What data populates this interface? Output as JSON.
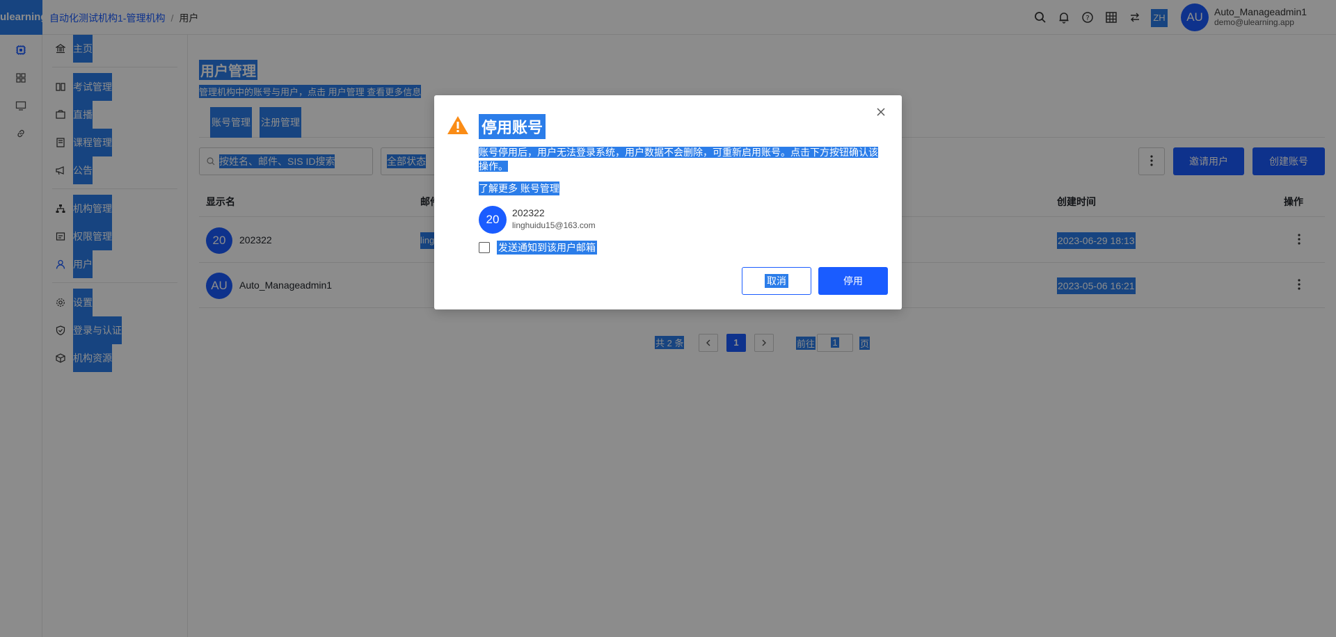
{
  "colors": {
    "accent": "#1a5cff",
    "selection": "#2b7de9",
    "warning": "#fa8c16"
  },
  "app": {
    "logo": "ulearning"
  },
  "breadcrumb": {
    "org": "自动化测试机构1-管理机构",
    "current": "用户"
  },
  "topbar": {
    "icons": [
      "search-icon",
      "bell-icon",
      "help-icon",
      "grid-icon",
      "switch-icon"
    ],
    "lang": "ZH",
    "avatar": "AU",
    "user_name": "Auto_Manageadmin1",
    "user_email": "demo@ulearning.app"
  },
  "rail": {
    "icons": [
      "chip-icon",
      "apps-icon",
      "monitor-icon",
      "link-icon"
    ]
  },
  "menu": {
    "items": [
      {
        "label": "主页",
        "icon": "bank-icon"
      },
      {
        "label": "考试管理",
        "icon": "book-icon"
      },
      {
        "label": "直播",
        "icon": "camera-icon"
      },
      {
        "label": "课程管理",
        "icon": "course-icon"
      },
      {
        "label": "公告",
        "icon": "megaphone-icon"
      },
      {
        "label": "机构管理",
        "icon": "org-icon"
      },
      {
        "label": "权限管理",
        "icon": "permission-icon"
      },
      {
        "label": "用户",
        "icon": "user-icon"
      },
      {
        "label": "设置",
        "icon": "gear-icon"
      },
      {
        "label": "登录与认证",
        "icon": "shield-icon"
      },
      {
        "label": "机构资源",
        "icon": "box-icon"
      }
    ]
  },
  "page": {
    "title": "用户管理",
    "desc_prefix": "管理机构中的账号与用户，点击",
    "desc_link": "用户管理",
    "desc_suffix": "查看更多信息",
    "tabs": [
      "账号管理",
      "注册管理"
    ],
    "search_placeholder": "按姓名、邮件、SIS ID搜索",
    "status_filter": "全部状态",
    "invite_button": "邀请用户",
    "create_button": "创建账号",
    "columns": {
      "name": "显示名",
      "email": "邮件",
      "created": "创建时间",
      "action": "操作"
    },
    "rows": [
      {
        "avatar": "20",
        "name": "202322",
        "email": "ling",
        "created": "2023-06-29 18:13"
      },
      {
        "avatar": "AU",
        "name": "Auto_Manageadmin1",
        "email": "",
        "created": "2023-05-06 16:21"
      }
    ],
    "pager": {
      "total": "共 2 条",
      "current": "1",
      "goto": "前往",
      "goto_value": "1",
      "page_unit": "页"
    }
  },
  "modal": {
    "title": "停用账号",
    "body": "账号停用后，用户无法登录系统，用户数据不会删除，可重新启用账号。点击下方按钮确认该操作。",
    "learn_more": "了解更多",
    "learn_link": "账号管理",
    "user_avatar": "20",
    "user_name": "202322",
    "user_email": "linghuidu15@163.com",
    "notify_label": "发送通知到该用户邮箱",
    "cancel_label": "取消",
    "confirm_label": "停用"
  }
}
